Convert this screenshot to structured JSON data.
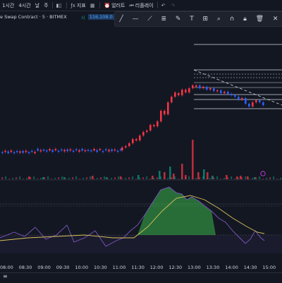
{
  "toolbar": {
    "interval_1h": "1시간",
    "interval_4h": "4시간",
    "interval_day": "날",
    "interval_week": "주",
    "chart_style_icon": "candles-icon",
    "indicators_label": "지표",
    "template_icon": "grid-icon",
    "alert_label": "얼러트",
    "replay_label": "리플레이",
    "undo_icon": "undo-icon",
    "redo_icon": "redo-icon"
  },
  "symbol": {
    "title": "e Swap Contract · 5 · BITMEX",
    "sell_label": "시",
    "price": "116,108.0"
  },
  "drawing_tools": [
    "trend-line-icon",
    "horizontal-line-icon",
    "ray-icon",
    "fib-icon",
    "brush-icon",
    "text-icon",
    "measure-icon",
    "zoom-icon",
    "magnet-icon",
    "lock-icon",
    "trash-icon",
    "close-icon"
  ],
  "time_axis": {
    "labels": [
      "08:00",
      "08:30",
      "09:00",
      "09:30",
      "10:00",
      "10:30",
      "11:00",
      "11:30",
      "12:00",
      "12:30",
      "13:00",
      "13:30",
      "14:00",
      "14:30",
      "15:00"
    ]
  },
  "bottom": {
    "left_glyph": "≡"
  },
  "colors": {
    "background": "#131722",
    "up": "#089981",
    "down": "#f23645",
    "blue_candle": "#2962ff",
    "line_level": "#ffffff",
    "oscillator": "#7e57c2",
    "signal": "#d8c15a",
    "fill_green": "#3bb54a"
  }
}
